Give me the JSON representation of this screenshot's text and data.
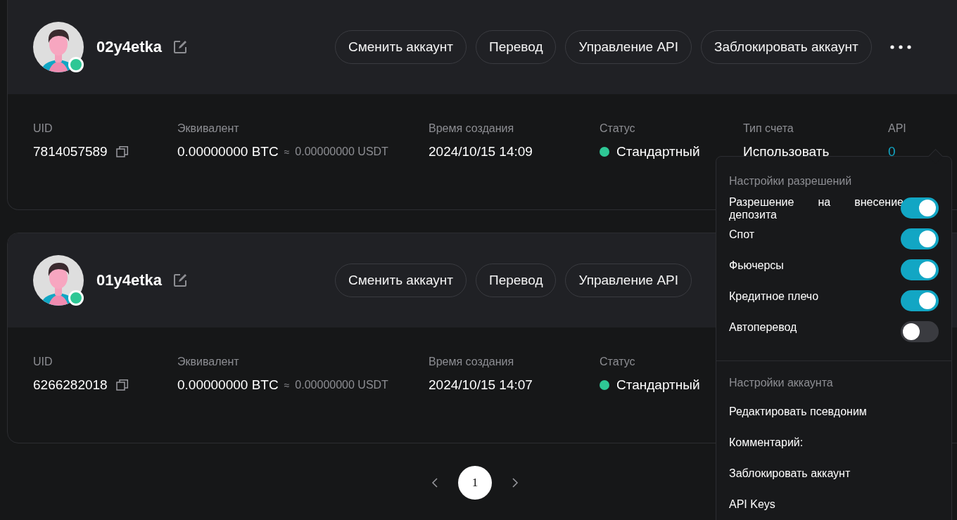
{
  "accounts": [
    {
      "name": "02y4etka",
      "online": true,
      "actions": [
        "Сменить аккаунт",
        "Перевод",
        "Управление API",
        "Заблокировать аккаунт"
      ],
      "more": true,
      "fields": [
        {
          "kind": "copy",
          "label": "UID",
          "value": "7814057589"
        },
        {
          "kind": "equivalent",
          "label": "Эквивалент",
          "value": "0.00000000 BTC",
          "approx": "≈",
          "secondary": "0.00000000 USDT"
        },
        {
          "kind": "plain",
          "label": "Время создания",
          "value": "2024/10/15 14:09"
        },
        {
          "kind": "status",
          "label": "Статус",
          "value": "Стандартный"
        },
        {
          "kind": "plain",
          "label": "Тип счета",
          "value": "Использовать"
        },
        {
          "kind": "link",
          "label": "API",
          "value": "0"
        }
      ]
    },
    {
      "name": "01y4etka",
      "online": true,
      "actions": [
        "Сменить аккаунт",
        "Перевод",
        "Управление API"
      ],
      "more": false,
      "fields": [
        {
          "kind": "copy",
          "label": "UID",
          "value": "6266282018"
        },
        {
          "kind": "equivalent",
          "label": "Эквивалент",
          "value": "0.00000000 BTC",
          "approx": "≈",
          "secondary": "0.00000000 USDT"
        },
        {
          "kind": "plain",
          "label": "Время создания",
          "value": "2024/10/15 14:07"
        },
        {
          "kind": "status",
          "label": "Статус",
          "value": "Стандартный"
        }
      ]
    }
  ],
  "menu": {
    "permissions": {
      "title": "Настройки разрешений",
      "toggles": [
        {
          "label": "Разрешение на внесение депозита",
          "on": true
        },
        {
          "label": "Спот",
          "on": true
        },
        {
          "label": "Фьючерсы",
          "on": true
        },
        {
          "label": "Кредитное плечо",
          "on": true
        },
        {
          "label": "Автоперевод",
          "on": false
        }
      ]
    },
    "account": {
      "title": "Настройки аккаунта",
      "items": [
        "Редактировать псевдоним",
        "Комментарий:",
        "Заблокировать аккаунт",
        "API Keys"
      ]
    }
  },
  "pagination": {
    "pages": [
      {
        "label": "1",
        "selected": true
      }
    ]
  }
}
